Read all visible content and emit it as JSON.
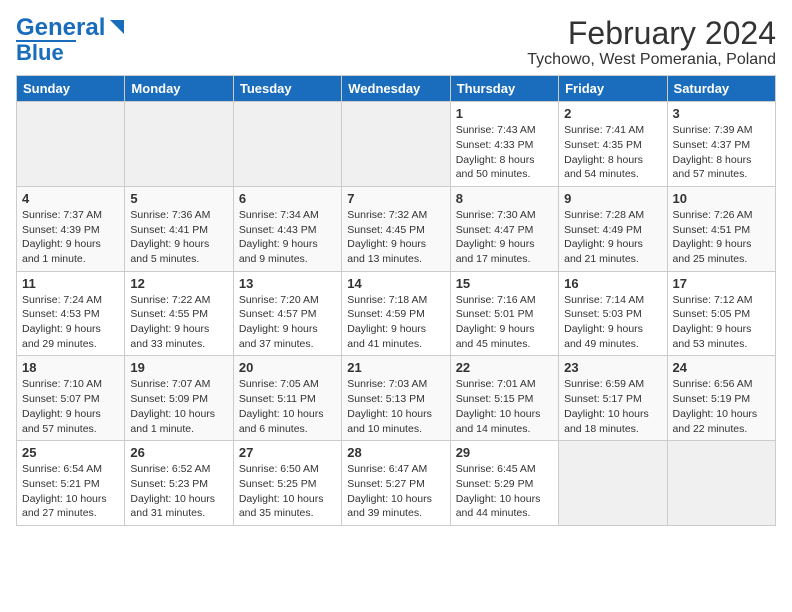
{
  "title": "February 2024",
  "subtitle": "Tychowo, West Pomerania, Poland",
  "logo": {
    "line1": "General",
    "line2": "Blue"
  },
  "days_of_week": [
    "Sunday",
    "Monday",
    "Tuesday",
    "Wednesday",
    "Thursday",
    "Friday",
    "Saturday"
  ],
  "weeks": [
    [
      {
        "day": "",
        "info": ""
      },
      {
        "day": "",
        "info": ""
      },
      {
        "day": "",
        "info": ""
      },
      {
        "day": "",
        "info": ""
      },
      {
        "day": "1",
        "info": "Sunrise: 7:43 AM\nSunset: 4:33 PM\nDaylight: 8 hours\nand 50 minutes."
      },
      {
        "day": "2",
        "info": "Sunrise: 7:41 AM\nSunset: 4:35 PM\nDaylight: 8 hours\nand 54 minutes."
      },
      {
        "day": "3",
        "info": "Sunrise: 7:39 AM\nSunset: 4:37 PM\nDaylight: 8 hours\nand 57 minutes."
      }
    ],
    [
      {
        "day": "4",
        "info": "Sunrise: 7:37 AM\nSunset: 4:39 PM\nDaylight: 9 hours\nand 1 minute."
      },
      {
        "day": "5",
        "info": "Sunrise: 7:36 AM\nSunset: 4:41 PM\nDaylight: 9 hours\nand 5 minutes."
      },
      {
        "day": "6",
        "info": "Sunrise: 7:34 AM\nSunset: 4:43 PM\nDaylight: 9 hours\nand 9 minutes."
      },
      {
        "day": "7",
        "info": "Sunrise: 7:32 AM\nSunset: 4:45 PM\nDaylight: 9 hours\nand 13 minutes."
      },
      {
        "day": "8",
        "info": "Sunrise: 7:30 AM\nSunset: 4:47 PM\nDaylight: 9 hours\nand 17 minutes."
      },
      {
        "day": "9",
        "info": "Sunrise: 7:28 AM\nSunset: 4:49 PM\nDaylight: 9 hours\nand 21 minutes."
      },
      {
        "day": "10",
        "info": "Sunrise: 7:26 AM\nSunset: 4:51 PM\nDaylight: 9 hours\nand 25 minutes."
      }
    ],
    [
      {
        "day": "11",
        "info": "Sunrise: 7:24 AM\nSunset: 4:53 PM\nDaylight: 9 hours\nand 29 minutes."
      },
      {
        "day": "12",
        "info": "Sunrise: 7:22 AM\nSunset: 4:55 PM\nDaylight: 9 hours\nand 33 minutes."
      },
      {
        "day": "13",
        "info": "Sunrise: 7:20 AM\nSunset: 4:57 PM\nDaylight: 9 hours\nand 37 minutes."
      },
      {
        "day": "14",
        "info": "Sunrise: 7:18 AM\nSunset: 4:59 PM\nDaylight: 9 hours\nand 41 minutes."
      },
      {
        "day": "15",
        "info": "Sunrise: 7:16 AM\nSunset: 5:01 PM\nDaylight: 9 hours\nand 45 minutes."
      },
      {
        "day": "16",
        "info": "Sunrise: 7:14 AM\nSunset: 5:03 PM\nDaylight: 9 hours\nand 49 minutes."
      },
      {
        "day": "17",
        "info": "Sunrise: 7:12 AM\nSunset: 5:05 PM\nDaylight: 9 hours\nand 53 minutes."
      }
    ],
    [
      {
        "day": "18",
        "info": "Sunrise: 7:10 AM\nSunset: 5:07 PM\nDaylight: 9 hours\nand 57 minutes."
      },
      {
        "day": "19",
        "info": "Sunrise: 7:07 AM\nSunset: 5:09 PM\nDaylight: 10 hours\nand 1 minute."
      },
      {
        "day": "20",
        "info": "Sunrise: 7:05 AM\nSunset: 5:11 PM\nDaylight: 10 hours\nand 6 minutes."
      },
      {
        "day": "21",
        "info": "Sunrise: 7:03 AM\nSunset: 5:13 PM\nDaylight: 10 hours\nand 10 minutes."
      },
      {
        "day": "22",
        "info": "Sunrise: 7:01 AM\nSunset: 5:15 PM\nDaylight: 10 hours\nand 14 minutes."
      },
      {
        "day": "23",
        "info": "Sunrise: 6:59 AM\nSunset: 5:17 PM\nDaylight: 10 hours\nand 18 minutes."
      },
      {
        "day": "24",
        "info": "Sunrise: 6:56 AM\nSunset: 5:19 PM\nDaylight: 10 hours\nand 22 minutes."
      }
    ],
    [
      {
        "day": "25",
        "info": "Sunrise: 6:54 AM\nSunset: 5:21 PM\nDaylight: 10 hours\nand 27 minutes."
      },
      {
        "day": "26",
        "info": "Sunrise: 6:52 AM\nSunset: 5:23 PM\nDaylight: 10 hours\nand 31 minutes."
      },
      {
        "day": "27",
        "info": "Sunrise: 6:50 AM\nSunset: 5:25 PM\nDaylight: 10 hours\nand 35 minutes."
      },
      {
        "day": "28",
        "info": "Sunrise: 6:47 AM\nSunset: 5:27 PM\nDaylight: 10 hours\nand 39 minutes."
      },
      {
        "day": "29",
        "info": "Sunrise: 6:45 AM\nSunset: 5:29 PM\nDaylight: 10 hours\nand 44 minutes."
      },
      {
        "day": "",
        "info": ""
      },
      {
        "day": "",
        "info": ""
      }
    ]
  ]
}
